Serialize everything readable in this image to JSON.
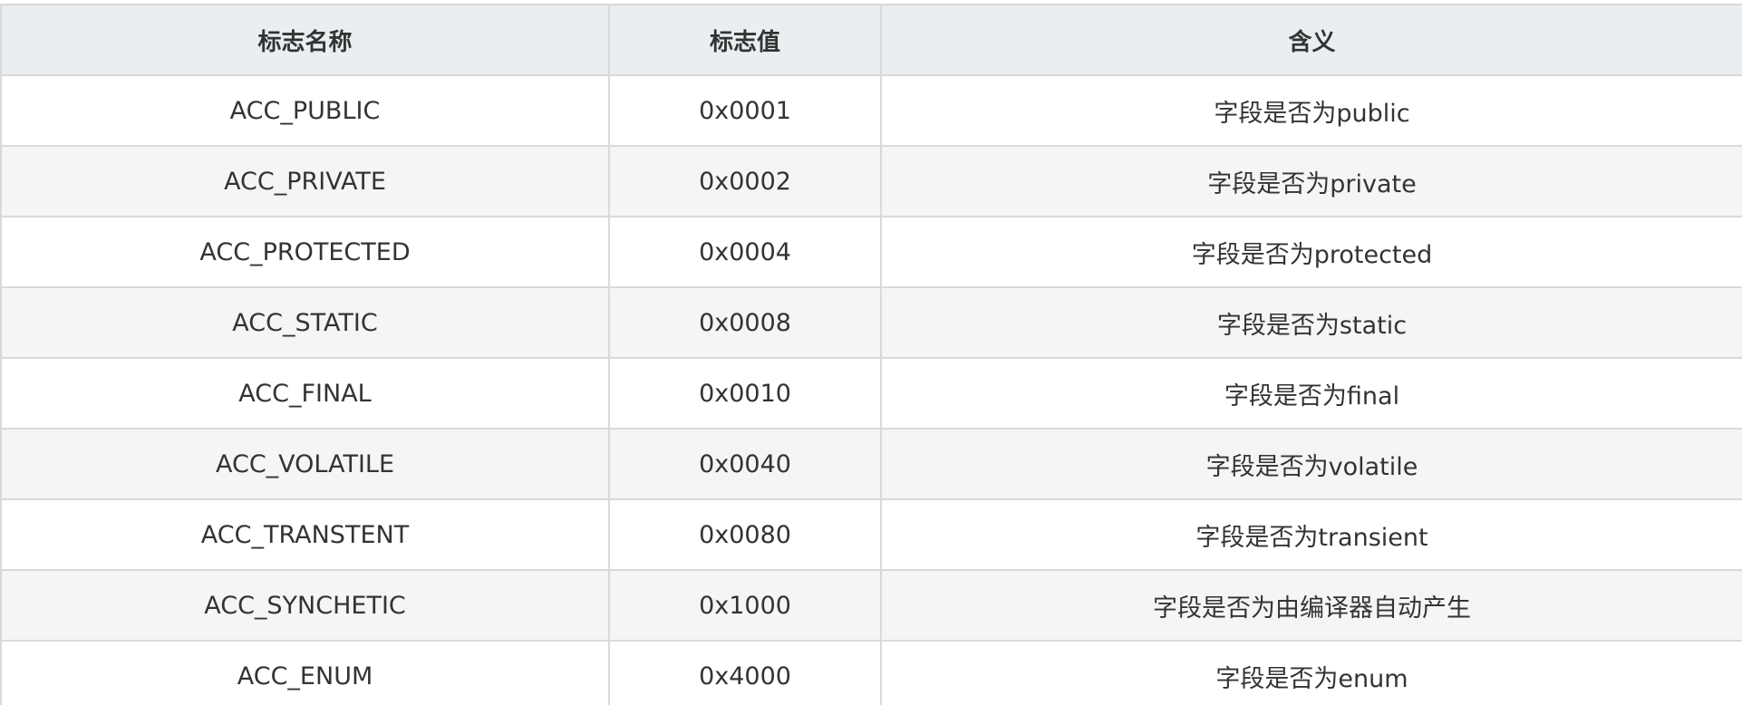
{
  "table": {
    "headers": [
      "标志名称",
      "标志值",
      "含义"
    ],
    "rows": [
      [
        "ACC_PUBLIC",
        "0x0001",
        "字段是否为public"
      ],
      [
        "ACC_PRIVATE",
        "0x0002",
        "字段是否为private"
      ],
      [
        "ACC_PROTECTED",
        "0x0004",
        "字段是否为protected"
      ],
      [
        "ACC_STATIC",
        "0x0008",
        "字段是否为static"
      ],
      [
        "ACC_FINAL",
        "0x0010",
        "字段是否为final"
      ],
      [
        "ACC_VOLATILE",
        "0x0040",
        "字段是否为volatile"
      ],
      [
        "ACC_TRANSTENT",
        "0x0080",
        "字段是否为transient"
      ],
      [
        "ACC_SYNCHETIC",
        "0x1000",
        "字段是否为由编译器自动产生"
      ],
      [
        "ACC_ENUM",
        "0x4000",
        "字段是否为enum"
      ]
    ]
  }
}
